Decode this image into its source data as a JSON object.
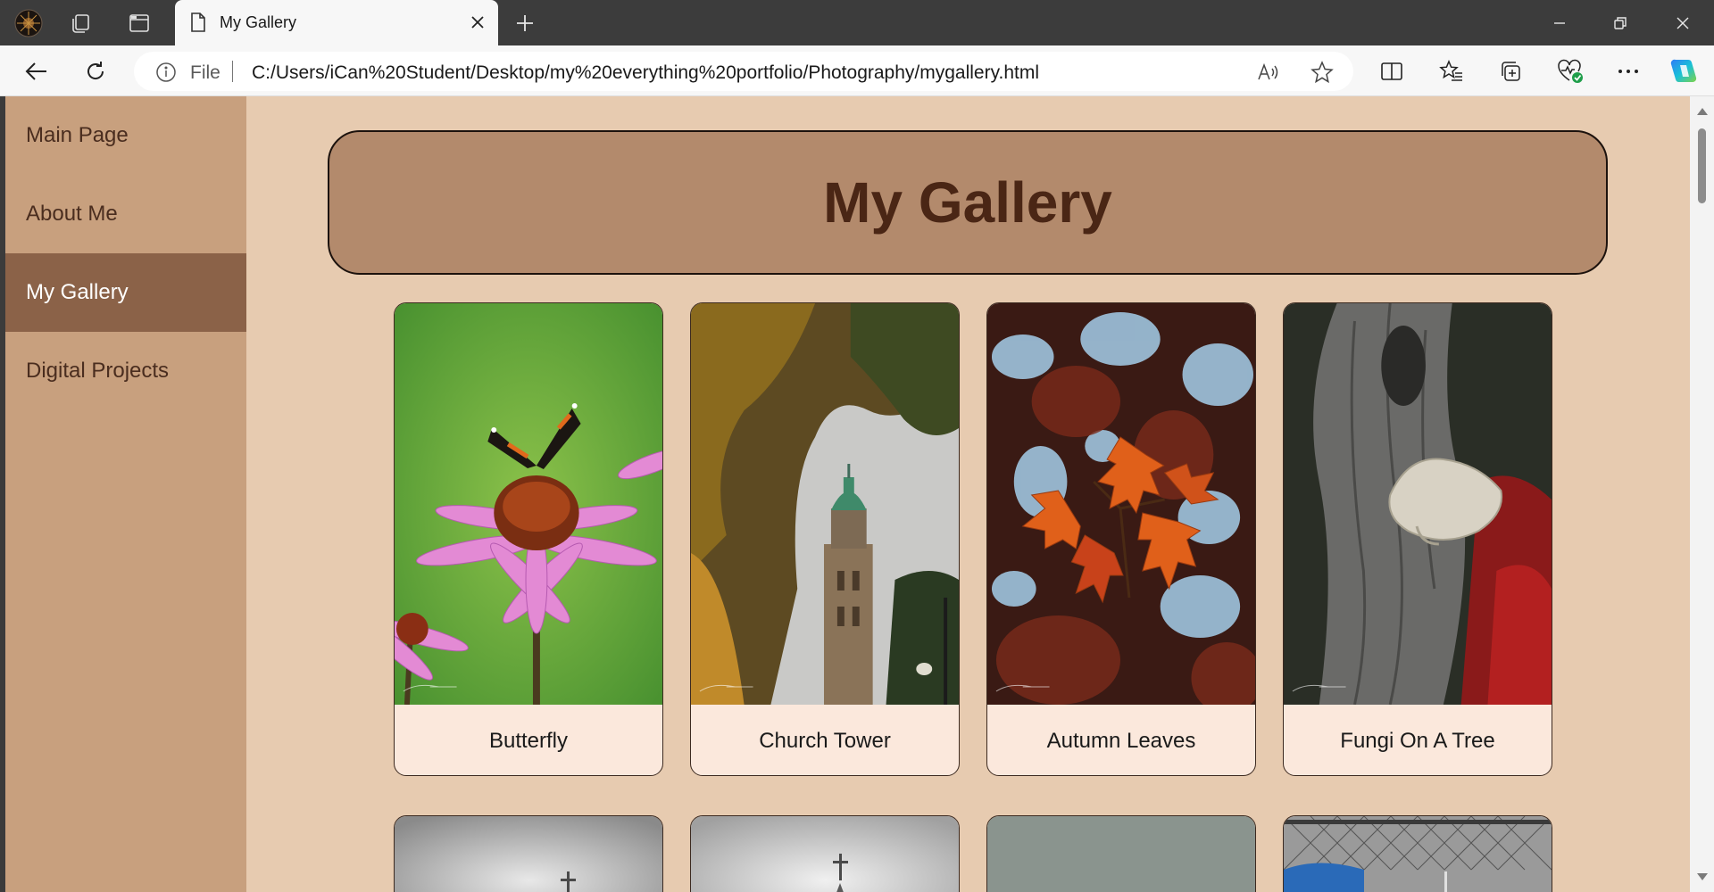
{
  "browser": {
    "tab_title": "My Gallery",
    "address": {
      "scheme_label": "File",
      "url": "C:/Users/iCan%20Student/Desktop/my%20everything%20portfolio/Photography/mygallery.html"
    }
  },
  "sidebar": {
    "items": [
      {
        "label": "Main Page",
        "active": false
      },
      {
        "label": "About Me",
        "active": false
      },
      {
        "label": "My Gallery",
        "active": true
      },
      {
        "label": "Digital Projects",
        "active": false
      }
    ]
  },
  "page": {
    "title": "My Gallery"
  },
  "gallery": {
    "items": [
      {
        "caption": "Butterfly"
      },
      {
        "caption": "Church Tower"
      },
      {
        "caption": "Autumn Leaves"
      },
      {
        "caption": "Fungi On A Tree"
      }
    ]
  },
  "colors": {
    "page_bg": "#e7cbb0",
    "sidebar_bg": "#c8a07e",
    "sidebar_active": "#8b6248",
    "banner_bg": "#b38a6c",
    "title_text": "#4a2615",
    "caption_bg": "#fbe8dc"
  },
  "icons": {
    "tab_bar": [
      "profile-avatar-icon",
      "workspaces-icon",
      "vertical-tabs-icon"
    ],
    "tab": [
      "page-icon",
      "close-icon"
    ],
    "window": [
      "minimize-icon",
      "restore-icon",
      "window-close-icon"
    ],
    "nav": [
      "back-icon",
      "refresh-icon",
      "info-icon",
      "read-aloud-icon",
      "favorite-star-icon"
    ],
    "toolbar": [
      "split-screen-icon",
      "favorites-icon",
      "collections-icon",
      "browser-essentials-icon",
      "more-icon",
      "copilot-icon"
    ]
  }
}
